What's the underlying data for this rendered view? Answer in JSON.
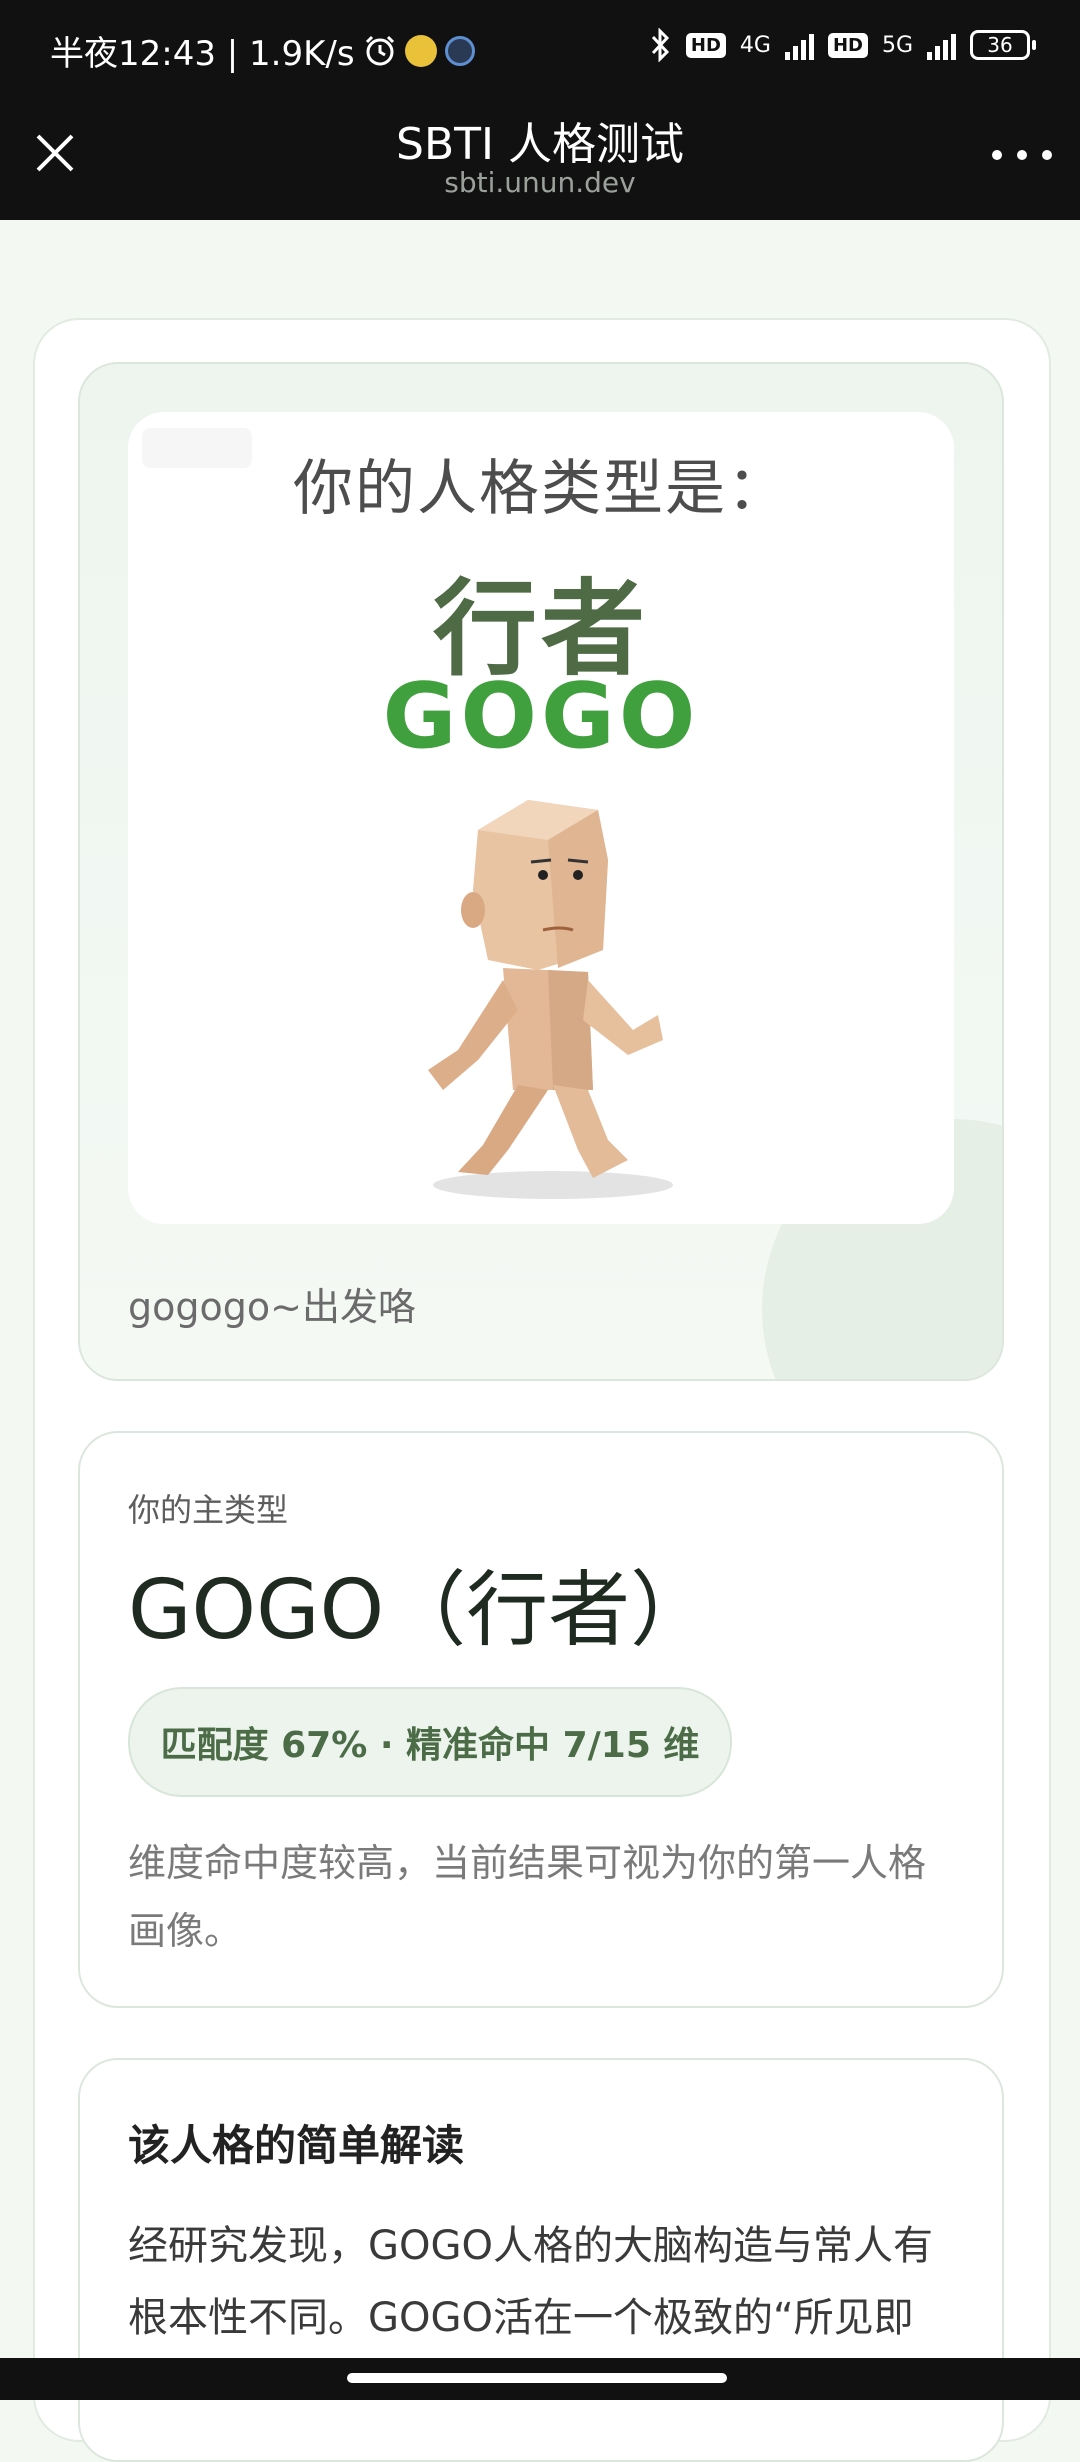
{
  "status_bar": {
    "time_text": "半夜12:43 | 1.9K/s",
    "network_4g": "4G",
    "network_5g": "5G",
    "hd_label": "HD",
    "battery": "36",
    "icons": [
      "alarm-icon",
      "app-icon",
      "app-icon-2",
      "bluetooth-icon",
      "signal-icon",
      "battery-icon"
    ]
  },
  "header": {
    "title": "SBTI 人格测试",
    "domain": "sbti.unun.dev"
  },
  "result_card": {
    "heading": "你的人格类型是：",
    "type_cn": "行者",
    "type_en": "GOGO",
    "caption": "gogogo~出发咯"
  },
  "type_card": {
    "label": "你的主类型",
    "name": "GOGO（行者）",
    "match_text": "匹配度 67% · 精准命中 7/15 维",
    "description": "维度命中度较高，当前结果可视为你的第一人格画像。"
  },
  "reading_card": {
    "title": "该人格的简单解读",
    "body": "经研究发现，GOGO人格的大脑构造与常人有根本性不同。GOGO活在一个极致的“所见即"
  },
  "colors": {
    "accent_green": "#3fa03d",
    "dark_green": "#4f6b45",
    "bar_bg": "#111111"
  }
}
